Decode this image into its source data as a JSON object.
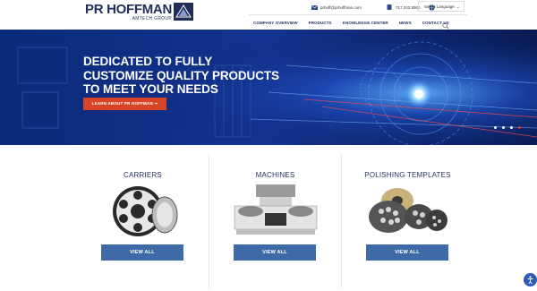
{
  "header": {
    "logo_main": "PR HOFFMAN",
    "logo_sub": "AMTECH GROUP",
    "email": "prhoff@prhoffman.com",
    "phone": "717.243.9900",
    "language": "Select Language"
  },
  "nav": {
    "items": [
      "COMPANY OVERVIEW",
      "PRODUCTS",
      "KNOWLEDGE CENTER",
      "NEWS",
      "CONTACT US"
    ]
  },
  "hero": {
    "headline": "DEDICATED TO FULLY CUSTOMIZE QUALITY PRODUCTS TO MEET YOUR NEEDS",
    "cta": "LEARN ABOUT PR HOFFMAN ➞",
    "slide_count": 4,
    "active_slide": 4
  },
  "products": [
    {
      "title": "CARRIERS",
      "button": "VIEW ALL"
    },
    {
      "title": "MACHINES",
      "button": "VIEW ALL"
    },
    {
      "title": "POLISHING TEMPLATES",
      "button": "VIEW ALL"
    }
  ],
  "colors": {
    "navy": "#1f2e5a",
    "accent": "#d84427",
    "button": "#3f6aa8",
    "hero_bg": "#0b1f63"
  }
}
